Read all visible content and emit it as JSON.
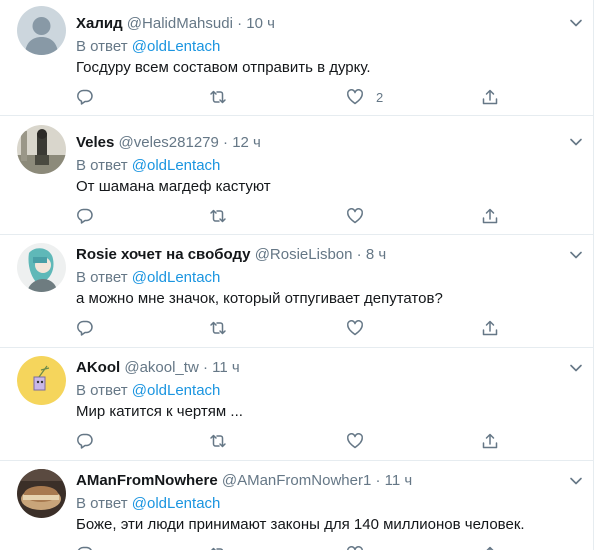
{
  "tweets": [
    {
      "name": "Халид",
      "handle": "@HalidMahsudi",
      "time": "10 ч",
      "reply_prefix": "В ответ",
      "reply_to": "@oldLentach",
      "text": "Госдуру всем составом отправить в дурку.",
      "reply_count": "",
      "retweet_count": "",
      "like_count": "2",
      "avatar": "default-avatar"
    },
    {
      "name": "Veles",
      "handle": "@veles281279",
      "time": "12 ч",
      "reply_prefix": "В ответ",
      "reply_to": "@oldLentach",
      "text": "От шамана магдеф кастуют",
      "reply_count": "",
      "retweet_count": "",
      "like_count": "",
      "avatar": "photo-avatar"
    },
    {
      "name": "Rosie хочет на свободу",
      "handle": "@RosieLisbon",
      "time": "8 ч",
      "reply_prefix": "В ответ",
      "reply_to": "@oldLentach",
      "text": "а можно мне значок, который отпугивает депутатов?",
      "reply_count": "",
      "retweet_count": "",
      "like_count": "",
      "avatar": "drawing-avatar"
    },
    {
      "name": "AKool",
      "handle": "@akool_tw",
      "time": "11 ч",
      "reply_prefix": "В ответ",
      "reply_to": "@oldLentach",
      "text": "Мир катится к чертям ...",
      "reply_count": "",
      "retweet_count": "",
      "like_count": "",
      "avatar": "yellow-avatar"
    },
    {
      "name": "AManFromNowhere",
      "handle": "@AManFromNowher1",
      "time": "11 ч",
      "reply_prefix": "В ответ",
      "reply_to": "@oldLentach",
      "text": "Боже, эти люди принимают законы для 140 миллионов человек.",
      "reply_count": "",
      "retweet_count": "",
      "like_count": "",
      "avatar": "food-avatar"
    }
  ],
  "colors": {
    "name": "#14171a",
    "secondary": "#657786",
    "link": "#1b95e0",
    "border": "#e6ecf0"
  }
}
